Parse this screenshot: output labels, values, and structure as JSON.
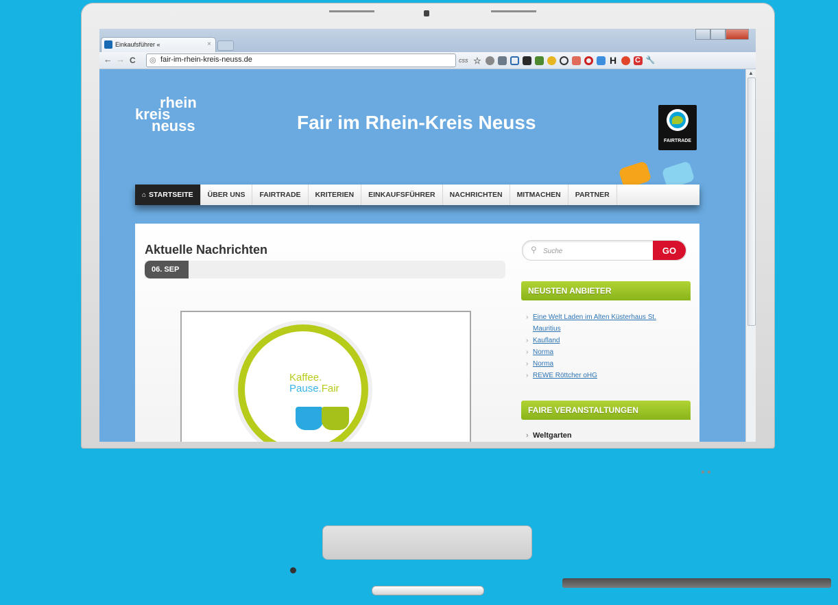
{
  "browser": {
    "tab_title": "Einkaufsführer «",
    "tab_close": "×",
    "url": "fair-im-rhein-kreis-neuss.de",
    "nav_back": "←",
    "nav_forward": "→",
    "nav_reload": "C",
    "ext_css_label": "css",
    "extensions": [
      {
        "name": "star-icon",
        "glyph": "☆",
        "color": "#777777"
      },
      {
        "name": "globe-icon",
        "glyph": "",
        "color": "#888888"
      },
      {
        "name": "wand-icon",
        "glyph": "",
        "color": "#6b7b8a"
      },
      {
        "name": "crop-icon",
        "glyph": "",
        "color": "#2c6bb0"
      },
      {
        "name": "pocket-icon",
        "glyph": "",
        "color": "#2a2a2a"
      },
      {
        "name": "chart-icon",
        "glyph": "",
        "color": "#4d8a2f"
      },
      {
        "name": "honey-icon",
        "glyph": "",
        "color": "#e7b422"
      },
      {
        "name": "target-icon",
        "glyph": "",
        "color": "#333333"
      },
      {
        "name": "note-icon",
        "glyph": "",
        "color": "#e06b5a"
      },
      {
        "name": "opera-icon",
        "glyph": "",
        "color": "#cc1f1f"
      },
      {
        "name": "cloud-icon",
        "glyph": "",
        "color": "#3e8ede"
      },
      {
        "name": "h-icon",
        "glyph": "H",
        "color": "#1b1b1b"
      },
      {
        "name": "o-icon",
        "glyph": "",
        "color": "#e2462a"
      },
      {
        "name": "c-icon",
        "glyph": "C",
        "color": "#d63030"
      },
      {
        "name": "wrench-icon",
        "glyph": "",
        "color": "#555555"
      }
    ]
  },
  "site": {
    "logo": {
      "line1": "rhein",
      "line2": "kreis",
      "line3": "neuss"
    },
    "title": "Fair im Rhein-Kreis Neuss",
    "fairtrade_label": "FAIRTRADE",
    "nav": [
      {
        "label": "STARTSEITE",
        "active": true
      },
      {
        "label": "ÜBER UNS"
      },
      {
        "label": "FAIRTRADE"
      },
      {
        "label": "KRITERIEN"
      },
      {
        "label": "EINKAUFSFÜHRER"
      },
      {
        "label": "NACHRICHTEN"
      },
      {
        "label": "MITMACHEN"
      },
      {
        "label": "PARTNER"
      }
    ],
    "news_heading": "Aktuelle Nachrichten",
    "date_badge": "06. SEP",
    "article_image_text": {
      "kaffee": "Kaffee.",
      "pause": "Pause.",
      "fair": "Fair"
    },
    "search": {
      "placeholder": "Suche",
      "button": "GO"
    },
    "widgets": {
      "newest_title": "NEUSTEN ANBIETER",
      "newest_items": [
        "Eine Welt Laden im Alten Küsterhaus St. Mauritius",
        "Kaufland",
        "Norma",
        "Norma",
        "REWE Röttcher oHG"
      ],
      "events_title": "FAIRE VERANSTALTUNGEN",
      "events_items": [
        "Weltgarten"
      ]
    }
  }
}
